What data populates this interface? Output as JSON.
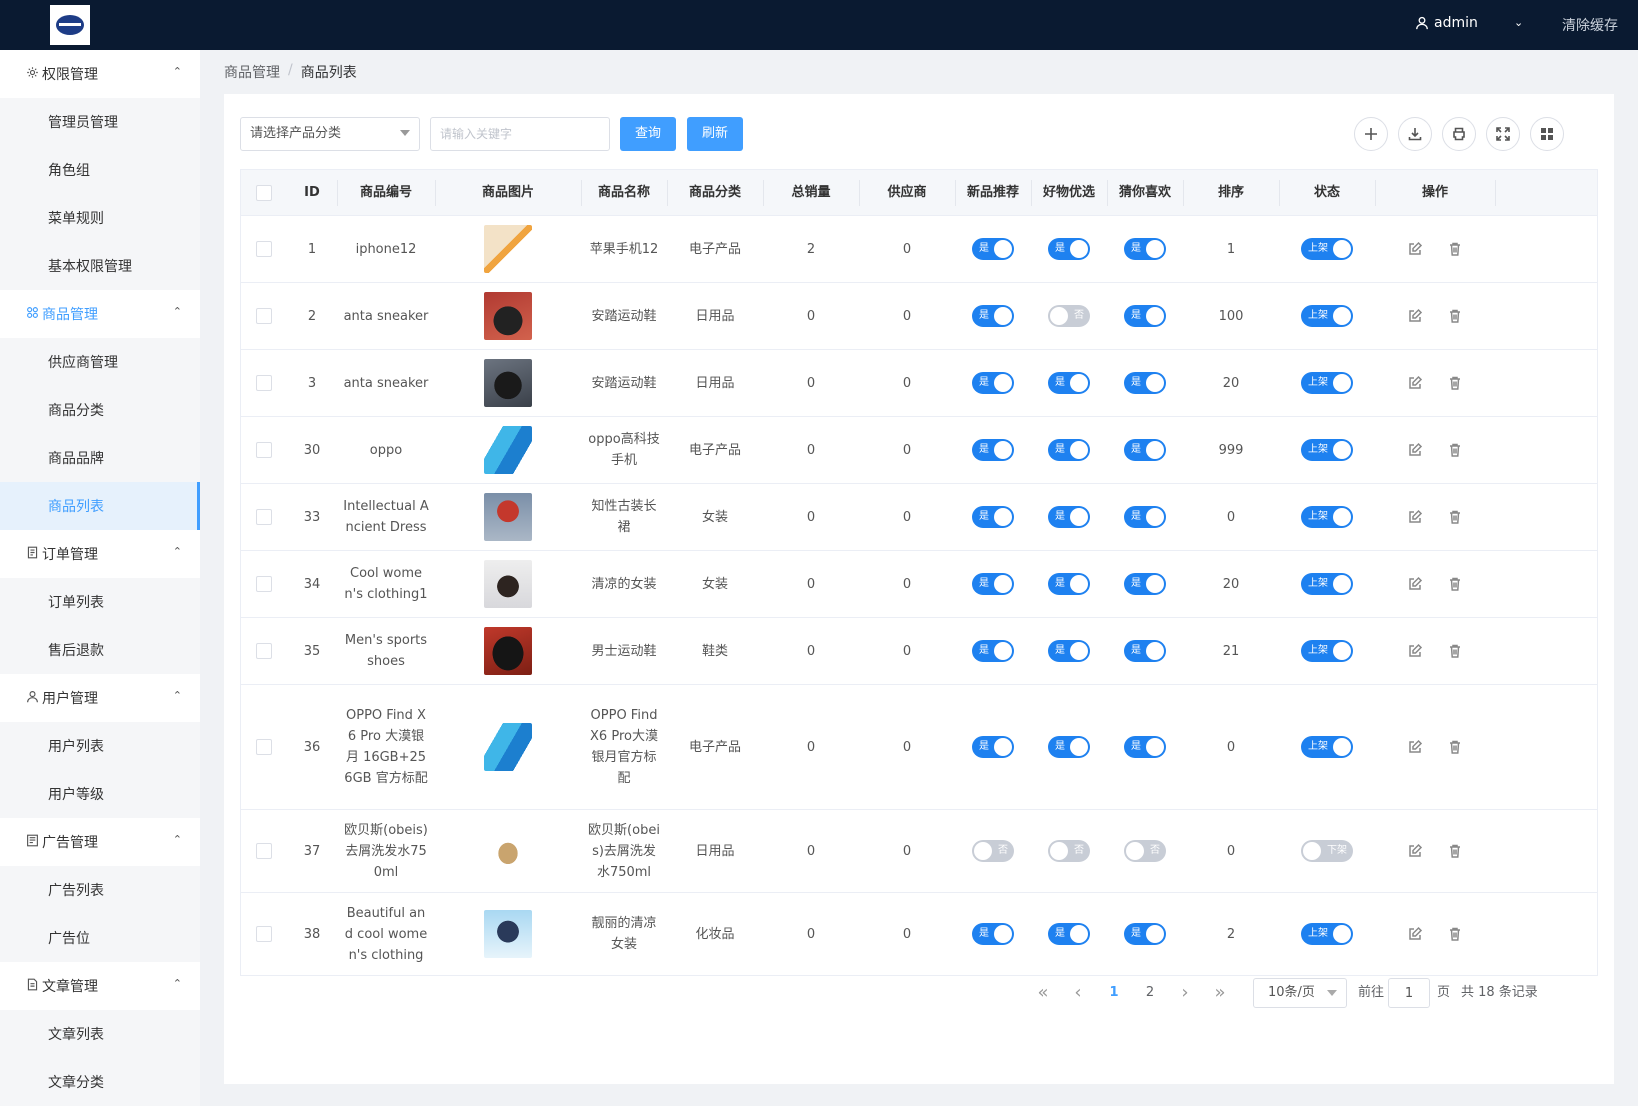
{
  "header": {
    "user": "admin",
    "clear_cache": "清除缓存"
  },
  "sidebar": [
    {
      "label": "权限管理",
      "icon": "gear-icon",
      "items": [
        "管理员管理",
        "角色组",
        "菜单规则",
        "基本权限管理"
      ]
    },
    {
      "label": "商品管理",
      "icon": "grid-icon",
      "active": true,
      "items": [
        "供应商管理",
        "商品分类",
        "商品品牌",
        "商品列表"
      ],
      "active_item": "商品列表"
    },
    {
      "label": "订单管理",
      "icon": "document-icon",
      "items": [
        "订单列表",
        "售后退款"
      ]
    },
    {
      "label": "用户管理",
      "icon": "user-icon",
      "items": [
        "用户列表",
        "用户等级"
      ]
    },
    {
      "label": "广告管理",
      "icon": "ad-icon",
      "items": [
        "广告列表",
        "广告位"
      ]
    },
    {
      "label": "文章管理",
      "icon": "article-icon",
      "items": [
        "文章列表",
        "文章分类"
      ]
    }
  ],
  "breadcrumb": {
    "parent": "商品管理",
    "separator": "/",
    "current": "商品列表"
  },
  "toolbar": {
    "category_placeholder": "请选择产品分类",
    "keyword_placeholder": "请输入关键字",
    "query_label": "查询",
    "refresh_label": "刷新",
    "tools": [
      "plus-icon",
      "download-icon",
      "print-icon",
      "fullscreen-icon",
      "columns-icon"
    ]
  },
  "table": {
    "columns": [
      "ID",
      "商品编号",
      "商品图片",
      "商品名称",
      "商品分类",
      "总销量",
      "供应商",
      "新品推荐",
      "好物优选",
      "猜你喜欢",
      "排序",
      "状态",
      "操作"
    ],
    "rows": [
      {
        "id": "1",
        "code": "iphone12",
        "img": "phone-gold",
        "name": "苹果手机12",
        "category": "电子产品",
        "sales": "2",
        "supplier": "0",
        "new": true,
        "good": true,
        "guess": true,
        "sort": "1",
        "status": true
      },
      {
        "id": "2",
        "code": "anta sneaker",
        "img": "sneaker-red",
        "name": "安踏运动鞋",
        "category": "日用品",
        "sales": "0",
        "supplier": "0",
        "new": true,
        "good": false,
        "guess": true,
        "sort": "100",
        "status": true
      },
      {
        "id": "3",
        "code": "anta sneaker",
        "img": "sneaker-dark",
        "name": "安踏运动鞋",
        "category": "日用品",
        "sales": "0",
        "supplier": "0",
        "new": true,
        "good": true,
        "guess": true,
        "sort": "20",
        "status": true
      },
      {
        "id": "30",
        "code": "oppo",
        "img": "phone-blue",
        "name": "oppo高科技手机",
        "category": "电子产品",
        "sales": "0",
        "supplier": "0",
        "new": true,
        "good": true,
        "guess": true,
        "sort": "999",
        "status": true
      },
      {
        "id": "33",
        "code": "Intellectual Ancient Dress",
        "img": "dress-red",
        "name": "知性古装长裙",
        "category": "女装",
        "sales": "0",
        "supplier": "0",
        "new": true,
        "good": true,
        "guess": true,
        "sort": "0",
        "status": true
      },
      {
        "id": "34",
        "code": "Cool women's clothing1",
        "img": "dress-black",
        "name": "清凉的女装",
        "category": "女装",
        "sales": "0",
        "supplier": "0",
        "new": true,
        "good": true,
        "guess": true,
        "sort": "20",
        "status": true
      },
      {
        "id": "35",
        "code": "Men's sports shoes",
        "img": "shoes-black",
        "name": "男士运动鞋",
        "category": "鞋类",
        "sales": "0",
        "supplier": "0",
        "new": true,
        "good": true,
        "guess": true,
        "sort": "21",
        "status": true
      },
      {
        "id": "36",
        "code": "OPPO Find X6 Pro 大漠银月 16GB+256GB 官方标配",
        "img": "phone-blue",
        "name": "OPPO Find X6 Pro大漠银月官方标配",
        "category": "电子产品",
        "sales": "0",
        "supplier": "0",
        "new": true,
        "good": true,
        "guess": true,
        "sort": "0",
        "status": true
      },
      {
        "id": "37",
        "code": "欧贝斯(obeis)去屑洗发水750ml",
        "img": "shampoo",
        "name": "欧贝斯(obeis)去屑洗发水750ml",
        "category": "日用品",
        "sales": "0",
        "supplier": "0",
        "new": false,
        "good": false,
        "guess": false,
        "sort": "0",
        "status": false
      },
      {
        "id": "38",
        "code": "Beautiful and cool women's clothing",
        "img": "woman-sky",
        "name": "靓丽的清凉女装",
        "category": "化妆品",
        "sales": "0",
        "supplier": "0",
        "new": true,
        "good": true,
        "guess": true,
        "sort": "2",
        "status": true
      }
    ],
    "yes": "是",
    "no": "否",
    "on_shelf": "上架",
    "off_shelf": "下架"
  },
  "pagination": {
    "pages": [
      "1",
      "2"
    ],
    "current": "1",
    "page_size": "10条/页",
    "goto_prefix": "前往",
    "goto_value": "1",
    "goto_suffix": "页",
    "total": "共 18 条记录"
  },
  "colors": {
    "primary": "#409eff",
    "header_bg": "#0a1a31",
    "switch_on": "#1e81f0",
    "switch_off": "#c8cdd6"
  }
}
